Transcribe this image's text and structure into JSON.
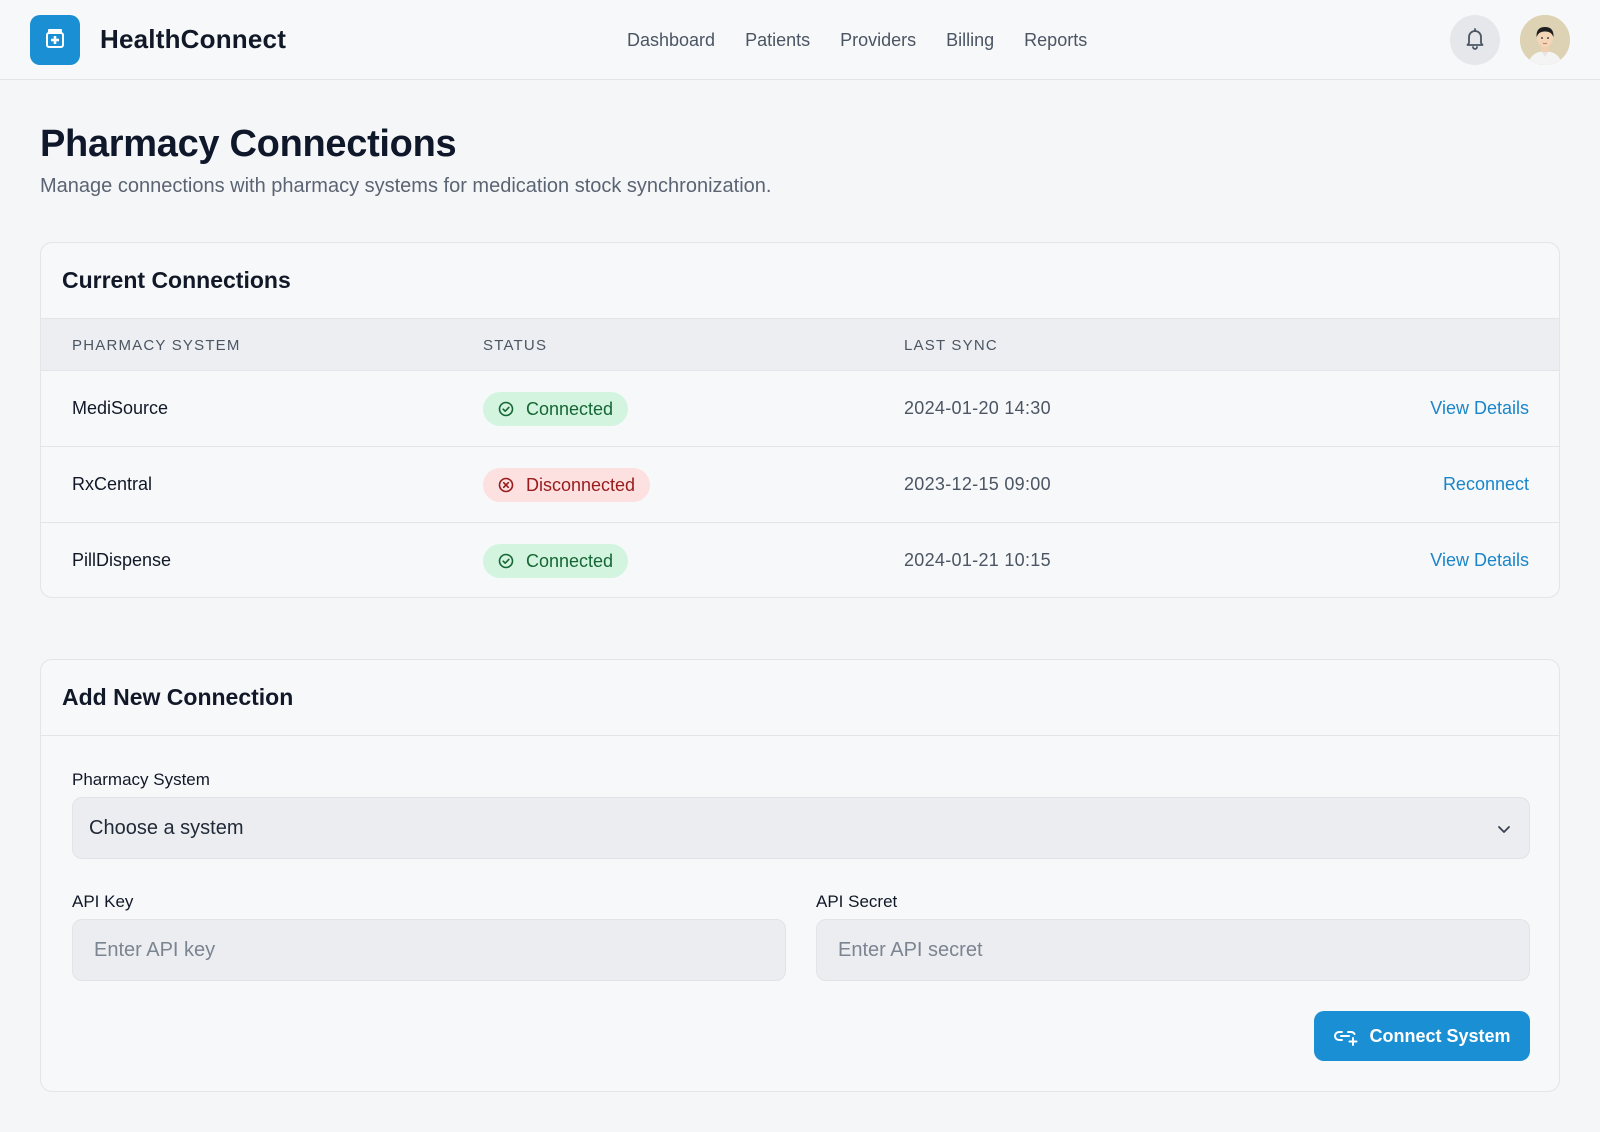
{
  "app": {
    "brand": "HealthConnect",
    "logo_icon": "medical-kit-icon",
    "accent_color": "#1a8fd4"
  },
  "nav": {
    "items": [
      {
        "label": "Dashboard"
      },
      {
        "label": "Patients"
      },
      {
        "label": "Providers"
      },
      {
        "label": "Billing"
      },
      {
        "label": "Reports"
      }
    ],
    "notification_icon": "bell-icon",
    "avatar_icon": "user-avatar"
  },
  "page": {
    "title": "Pharmacy Connections",
    "subtitle": "Manage connections with pharmacy systems for medication stock synchronization."
  },
  "connections": {
    "title": "Current Connections",
    "columns": [
      "PHARMACY SYSTEM",
      "STATUS",
      "LAST SYNC"
    ],
    "rows": [
      {
        "name": "MediSource",
        "status": "Connected",
        "status_type": "connected",
        "last_sync": "2024-01-20 14:30",
        "action": "View Details"
      },
      {
        "name": "RxCentral",
        "status": "Disconnected",
        "status_type": "disconnected",
        "last_sync": "2023-12-15 09:00",
        "action": "Reconnect"
      },
      {
        "name": "PillDispense",
        "status": "Connected",
        "status_type": "connected",
        "last_sync": "2024-01-21 10:15",
        "action": "View Details"
      }
    ],
    "status_colors": {
      "connected_bg": "#d3f5e0",
      "connected_text": "#166534",
      "disconnected_bg": "#fde0e0",
      "disconnected_text": "#991b1b"
    }
  },
  "add_connection": {
    "title": "Add New Connection",
    "system_label": "Pharmacy System",
    "system_selected": "Choose a system",
    "api_key_label": "API Key",
    "api_key_placeholder": "Enter API key",
    "api_secret_label": "API Secret",
    "api_secret_placeholder": "Enter API secret",
    "submit_label": "Connect System",
    "submit_icon": "link-add-icon"
  }
}
